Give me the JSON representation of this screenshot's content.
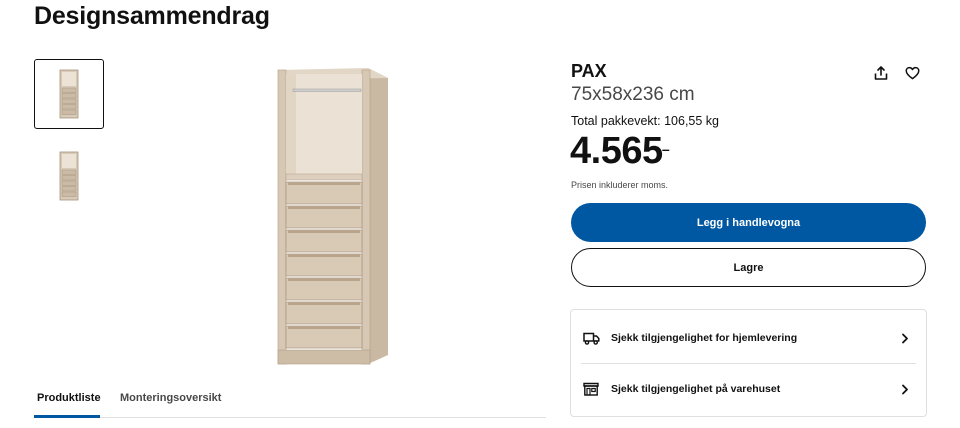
{
  "page": {
    "title": "Designsammendrag"
  },
  "gallery": {
    "thumbnails": [
      "pax-wardrobe-front-thumbnail",
      "pax-wardrobe-angle-thumbnail"
    ],
    "selected_index": 0
  },
  "tabs": [
    {
      "label": "Produktliste",
      "active": true
    },
    {
      "label": "Monteringsoversikt",
      "active": false
    }
  ],
  "product": {
    "name": "PAX",
    "dimensions": "75x58x236 cm",
    "package_weight": "Total pakkevekt: 106,55 kg",
    "price": "4.565",
    "price_suffix": ",–",
    "vat_note": "Prisen inkluderer moms."
  },
  "actions": {
    "share_icon": "share-icon",
    "favorite_icon": "heart-icon",
    "add_to_cart_label": "Legg i handlevogna",
    "save_label": "Lagre"
  },
  "availability": [
    {
      "icon": "truck-icon",
      "label": "Sjekk tilgjengelighet for hjemlevering"
    },
    {
      "icon": "store-icon",
      "label": "Sjekk tilgjengelighet på varehuset"
    }
  ],
  "colors": {
    "primary_blue": "#0058a3",
    "text": "#111111",
    "muted_text": "#484848",
    "divider": "#dfdfdf",
    "wood_light": "#e8ddd0",
    "wood_mid": "#d8cab8",
    "wood_dark": "#b9a58c"
  }
}
